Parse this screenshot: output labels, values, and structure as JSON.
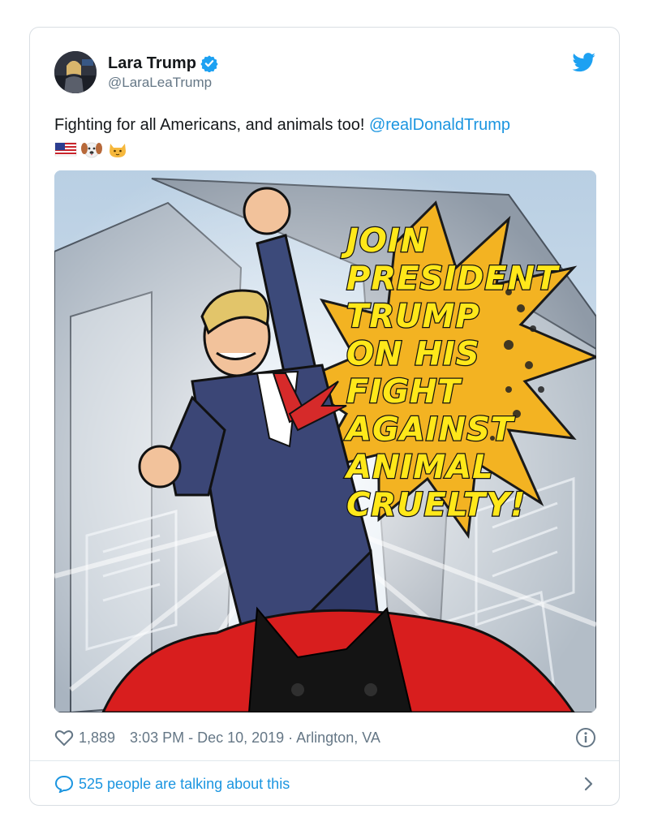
{
  "tweet": {
    "display_name": "Lara Trump",
    "handle": "@LaraLeaTrump",
    "text": "Fighting for all Americans, and animals too! ",
    "mention": "@realDonaldTrump",
    "emojis": [
      "us-flag-emoji",
      "dog-face-emoji",
      "cat-face-emoji"
    ]
  },
  "media": {
    "poster_lines": [
      "JOIN",
      "PRESIDENT",
      "TRUMP",
      "ON HIS",
      "FIGHT",
      "AGAINST",
      "ANIMAL",
      "CRUELTY!"
    ]
  },
  "meta": {
    "likes": "1,889",
    "timestamp": "3:03 PM - Dec 10, 2019 · Arlington, VA"
  },
  "footer": {
    "conversation": "525 people are talking about this"
  },
  "colors": {
    "accent": "#1b95e0",
    "muted": "#657786",
    "poster_yellow": "#ffe81a",
    "burst_orange": "#f3b322"
  },
  "icons": {
    "verified": "verified-badge-icon",
    "brand": "twitter-bird-icon",
    "like": "heart-icon",
    "info": "info-icon",
    "reply": "speech-bubble-icon",
    "more": "chevron-right-icon"
  }
}
